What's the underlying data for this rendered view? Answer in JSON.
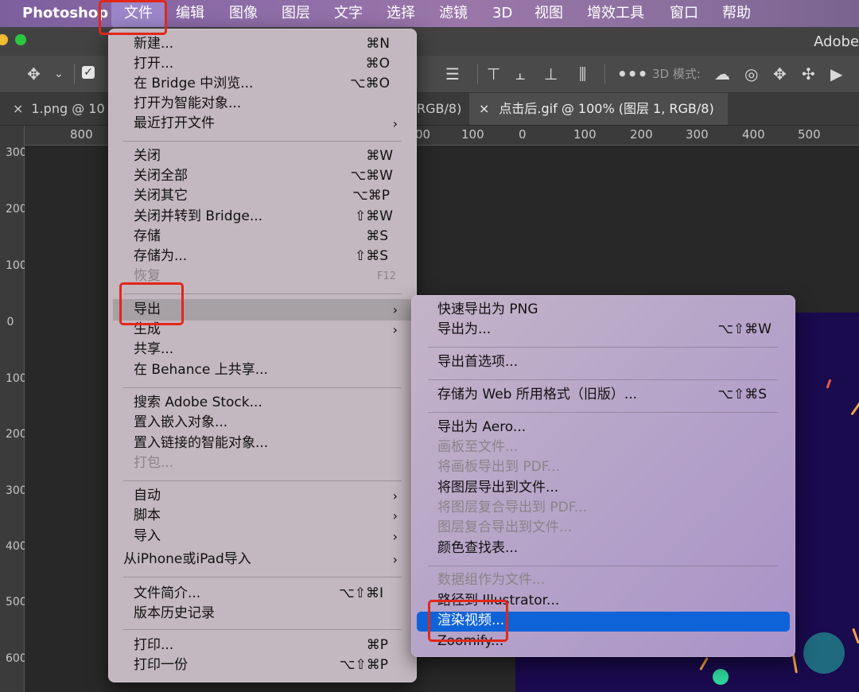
{
  "menubar": {
    "app": "Photoshop",
    "items": [
      "文件",
      "编辑",
      "图像",
      "图层",
      "文字",
      "选择",
      "滤镜",
      "3D",
      "视图",
      "增效工具",
      "窗口",
      "帮助"
    ]
  },
  "window": {
    "title_right": "Adobe"
  },
  "options_bar": {
    "mode_label": "3D 模式:"
  },
  "tabs": [
    {
      "label": "1.png @ 10"
    },
    {
      "label": "RGB/8)"
    },
    {
      "label": "点击后.gif @ 100% (图层 1, RGB/8)"
    }
  ],
  "ruler": {
    "h_ticks": [
      "800",
      "00",
      "100",
      "0",
      "100",
      "200",
      "300",
      "400",
      "500"
    ],
    "v_ticks": [
      "300",
      "200",
      "100",
      "0",
      "100",
      "200",
      "300",
      "400",
      "500",
      "600"
    ]
  },
  "file_menu": {
    "items": [
      {
        "label": "新建...",
        "shortcut": "⌘N"
      },
      {
        "label": "打开...",
        "shortcut": "⌘O"
      },
      {
        "label": "在 Bridge 中浏览...",
        "shortcut": "⌥⌘O"
      },
      {
        "label": "打开为智能对象...",
        "shortcut": ""
      },
      {
        "label": "最近打开文件",
        "submenu": "›"
      },
      {
        "label": "关闭",
        "shortcut": "⌘W"
      },
      {
        "label": "关闭全部",
        "shortcut": "⌥⌘W"
      },
      {
        "label": "关闭其它",
        "shortcut": "⌥⌘P"
      },
      {
        "label": "关闭并转到 Bridge...",
        "shortcut": "⇧⌘W"
      },
      {
        "label": "存储",
        "shortcut": "⌘S"
      },
      {
        "label": "存储为...",
        "shortcut": "⇧⌘S"
      },
      {
        "label": "恢复",
        "shortcut": "F12",
        "disabled": true
      },
      {
        "label": "导出",
        "submenu": "›",
        "highlighted": true
      },
      {
        "label": "生成",
        "submenu": "›"
      },
      {
        "label": "共享..."
      },
      {
        "label": "在 Behance 上共享..."
      },
      {
        "label": "搜索 Adobe Stock..."
      },
      {
        "label": "置入嵌入对象..."
      },
      {
        "label": "置入链接的智能对象..."
      },
      {
        "label": "打包...",
        "disabled": true
      },
      {
        "label": "自动",
        "submenu": "›"
      },
      {
        "label": "脚本",
        "submenu": "›"
      },
      {
        "label": "导入",
        "submenu": "›"
      },
      {
        "label": "从iPhone或iPad导入",
        "submenu": "›"
      },
      {
        "label": "文件简介...",
        "shortcut": "⌥⇧⌘I"
      },
      {
        "label": "版本历史记录"
      },
      {
        "label": "打印...",
        "shortcut": "⌘P"
      },
      {
        "label": "打印一份",
        "shortcut": "⌥⇧⌘P"
      }
    ]
  },
  "export_menu": {
    "items": [
      {
        "label": "快速导出为 PNG"
      },
      {
        "label": "导出为...",
        "shortcut": "⌥⇧⌘W"
      },
      {
        "label": "导出首选项..."
      },
      {
        "label": "存储为 Web 所用格式（旧版）...",
        "shortcut": "⌥⇧⌘S"
      },
      {
        "label": "导出为 Aero..."
      },
      {
        "label": "画板至文件...",
        "disabled": true
      },
      {
        "label": "将画板导出到 PDF...",
        "disabled": true
      },
      {
        "label": "将图层导出到文件..."
      },
      {
        "label": "将图层复合导出到 PDF...",
        "disabled": true
      },
      {
        "label": "图层复合导出到文件...",
        "disabled": true
      },
      {
        "label": "颜色查找表..."
      },
      {
        "label": "数据组作为文件...",
        "disabled": true
      },
      {
        "label": "路径到 Illustrator..."
      },
      {
        "label": "渲染视频...",
        "highlighted": true
      },
      {
        "label": "Zoomify..."
      }
    ]
  },
  "colors": {
    "highlight_blue": "#0f63d9",
    "annotation_red": "#e0271a",
    "menubar_purple": "#8b6aa6",
    "artboard_navy": "#1a0a4e"
  }
}
